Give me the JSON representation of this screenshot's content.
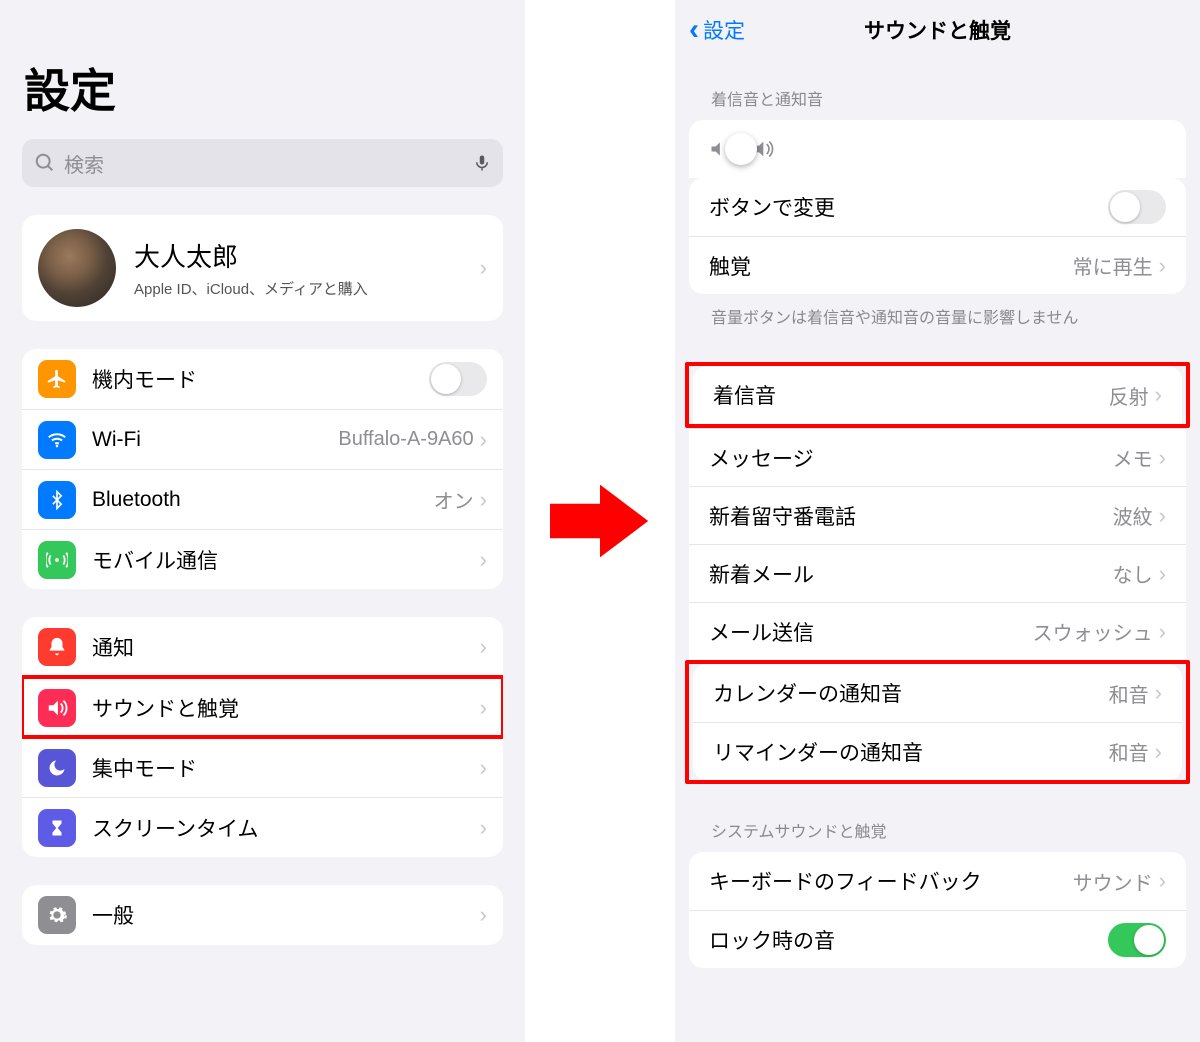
{
  "left": {
    "title": "設定",
    "search_placeholder": "検索",
    "profile": {
      "name": "大人太郎",
      "subtitle": "Apple ID、iCloud、メディアと購入"
    },
    "group1": [
      {
        "key": "airplane",
        "label": "機内モード",
        "icon": "airplane-icon",
        "bg": "bg-orange",
        "toggle": false
      },
      {
        "key": "wifi",
        "label": "Wi-Fi",
        "icon": "wifi-icon",
        "bg": "bg-blue",
        "value": "Buffalo-A-9A60"
      },
      {
        "key": "bluetooth",
        "label": "Bluetooth",
        "icon": "bluetooth-icon",
        "bg": "bg-blue",
        "value": "オン"
      },
      {
        "key": "cellular",
        "label": "モバイル通信",
        "icon": "antenna-icon",
        "bg": "bg-green"
      }
    ],
    "group2": [
      {
        "key": "notifications",
        "label": "通知",
        "icon": "bell-icon",
        "bg": "bg-red"
      },
      {
        "key": "sounds",
        "label": "サウンドと触覚",
        "icon": "speaker-icon",
        "bg": "bg-pink",
        "highlight": true
      },
      {
        "key": "focus",
        "label": "集中モード",
        "icon": "moon-icon",
        "bg": "bg-purple"
      },
      {
        "key": "screentime",
        "label": "スクリーンタイム",
        "icon": "hourglass-icon",
        "bg": "bg-indigo"
      }
    ],
    "group3": [
      {
        "key": "general",
        "label": "一般",
        "icon": "gear-icon",
        "bg": "bg-gray"
      }
    ]
  },
  "right": {
    "back_label": "設定",
    "title": "サウンドと触覚",
    "section1_header": "着信音と通知音",
    "slider_percent": 42,
    "rows_top": [
      {
        "label": "ボタンで変更",
        "toggle": false
      },
      {
        "label": "触覚",
        "value": "常に再生"
      }
    ],
    "footer1": "音量ボタンは着信音や通知音の音量に影響しません",
    "sound_rows": [
      {
        "label": "着信音",
        "value": "反射",
        "highlight_group": 1
      },
      {
        "label": "メッセージ",
        "value": "メモ"
      },
      {
        "label": "新着留守番電話",
        "value": "波紋"
      },
      {
        "label": "新着メール",
        "value": "なし"
      },
      {
        "label": "メール送信",
        "value": "スウォッシュ"
      },
      {
        "label": "カレンダーの通知音",
        "value": "和音",
        "highlight_group": 2
      },
      {
        "label": "リマインダーの通知音",
        "value": "和音",
        "highlight_group": 2
      }
    ],
    "section3_header": "システムサウンドと触覚",
    "rows_bottom": [
      {
        "label": "キーボードのフィードバック",
        "value": "サウンド"
      },
      {
        "label": "ロック時の音",
        "toggle": true
      }
    ]
  },
  "colors": {
    "accent": "#007aff",
    "highlight": "#ff0000"
  }
}
